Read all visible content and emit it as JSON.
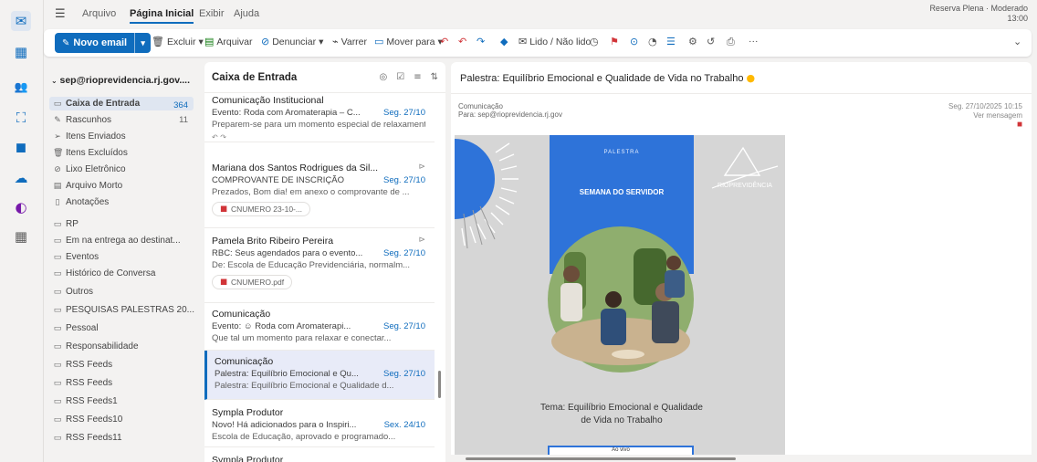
{
  "rail": [
    {
      "icon": "mail-icon",
      "glyph": "✉",
      "color": "#0f6cbd"
    },
    {
      "icon": "calendar-icon",
      "glyph": "▦",
      "color": "#0f6cbd"
    },
    {
      "icon": "people-icon",
      "glyph": "👥",
      "color": "#0f6cbd"
    },
    {
      "icon": "org-icon",
      "glyph": "⛶",
      "color": "#0f6cbd"
    },
    {
      "icon": "files-icon",
      "glyph": "◼",
      "color": "#0f6cbd"
    },
    {
      "icon": "onedrive-icon",
      "glyph": "☁",
      "color": "#0f6cbd"
    },
    {
      "icon": "loop-icon",
      "glyph": "◐",
      "color": "#7719aa"
    },
    {
      "icon": "apps-icon",
      "glyph": "▦",
      "color": "#616161"
    }
  ],
  "topbar": {
    "tabs": [
      "Arquivo",
      "Página Inicial",
      "Exibir",
      "Ajuda"
    ],
    "device_label_1": "Reserva Plena · Moderado",
    "device_label_2": "13:00"
  },
  "toolbar": {
    "new_email": "Novo email",
    "excluir": "Excluir",
    "arquivar": "Arquivar",
    "denunciar": "Denunciar",
    "varrer": "Varrer",
    "mover_para": "Mover para",
    "lido": "Lido / Não lido",
    "more": "···"
  },
  "folders": {
    "account": "sep@rioprevidencia.rj.gov....",
    "inbox": "Caixa de Entrada",
    "inbox_count": "364",
    "items": [
      "Rascunhos",
      "Itens Enviados",
      "Itens Excluídos",
      "Lixo Eletrônico",
      "Arquivo Morto",
      "Anotações",
      "RP",
      "Em na entrega ao destinat...",
      "Eventos",
      "Histórico de Conversa",
      "Outros",
      "PESQUISAS PALESTRAS 20...",
      "Pessoal",
      "Responsabilidade",
      "RSS Feeds",
      "RSS Feeds",
      "RSS Feeds1",
      "RSS Feeds10",
      "RSS Feeds11"
    ],
    "rascunhos_count": "11"
  },
  "list": {
    "title": "Caixa de Entrada",
    "messages": [
      {
        "from": "Comunicação Institucional",
        "line": "Evento: Roda com Aromaterapia – C...",
        "date": "Seg. 27/10",
        "preview": "Preparem-se para um momento especial de relaxamento...",
        "att": "",
        "sel": false
      },
      {
        "from": "Mariana dos Santos Rodrigues da Sil...",
        "line": "COMPROVANTE DE INSCRIÇÃO",
        "date": "Seg. 27/10",
        "preview": "Prezados, Bom dia! em anexo o comprovante de ...",
        "att": "CNUMERO 23-10-...",
        "sel": false
      },
      {
        "from": "Pamela Brito Ribeiro Pereira",
        "line": "RBC: Seus agendados para o evento...",
        "date": "Seg. 27/10",
        "preview": "De: Escola de Educação Previdenciária, normalm...",
        "att": "CNUMERO.pdf",
        "sel": false
      },
      {
        "from": "Comunicação",
        "line": "Evento: ☺ Roda com Aromaterapi...",
        "date": "Seg. 27/10",
        "preview": "Que tal um momento para relaxar e conectar...",
        "att": "",
        "sel": false
      },
      {
        "from": "Comunicação",
        "line": "Palestra: Equilíbrio Emocional e Qu...",
        "date": "Seg. 27/10",
        "preview": "Palestra: Equilíbrio Emocional e Qualidade d...",
        "att": "",
        "sel": true
      },
      {
        "from": "Sympla Produtor",
        "line": "Novo! Há adicionados para o Inspiri...",
        "date": "Sex. 24/10",
        "preview": "Escola de Educação, aprovado e programado...",
        "att": "",
        "sel": false
      },
      {
        "from": "Sympla Produtor",
        "line": "",
        "date": "",
        "preview": "",
        "att": "",
        "sel": false
      }
    ]
  },
  "reading": {
    "subject": "Palestra: Equilíbrio Emocional e Qualidade de Vida no Trabalho",
    "sender_1": "Comunicação",
    "sender_2": "Para: sep@rioprevidencia.rj.gov",
    "hdr_right_1": "Seg. 27/10/2025 10:15",
    "hdr_right_2": "Ver mensagem",
    "poster": {
      "palestra": "PALESTRA",
      "semana": "SEMANA DO SERVIDOR",
      "tema": "Tema: Equilíbrio Emocional e Qualidade de Vida no Trabalho",
      "cta": "Ao vivo",
      "logo": "RIOPREVIDÊNCIA"
    }
  }
}
